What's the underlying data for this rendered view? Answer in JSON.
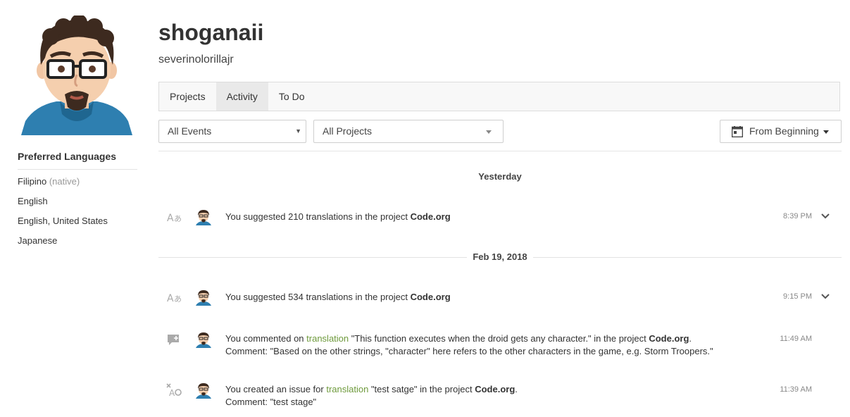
{
  "profile": {
    "display_name": "shoganaii",
    "username": "severinolorillajr"
  },
  "languages": {
    "title": "Preferred Languages",
    "items": [
      {
        "name": "Filipino",
        "note": "(native)"
      },
      {
        "name": "English",
        "note": ""
      },
      {
        "name": "English, United States",
        "note": ""
      },
      {
        "name": "Japanese",
        "note": ""
      }
    ]
  },
  "tabs": [
    {
      "label": "Projects",
      "active": false
    },
    {
      "label": "Activity",
      "active": true
    },
    {
      "label": "To Do",
      "active": false
    }
  ],
  "filters": {
    "events": "All Events",
    "projects": "All Projects",
    "date_range": "From Beginning"
  },
  "feed": {
    "groups": [
      {
        "date": "Yesterday"
      },
      {
        "date": "Feb 19, 2018"
      }
    ],
    "events": [
      {
        "icon": "translate-icon",
        "pre": "You suggested 210 translations in the project ",
        "project": "Code.org",
        "time": "8:39 PM"
      },
      {
        "icon": "translate-icon",
        "pre": "You suggested 534 translations in the project ",
        "project": "Code.org",
        "time": "9:15 PM"
      },
      {
        "icon": "comment-icon",
        "pre": "You commented on ",
        "link": "translation",
        "mid": " \"This function executes when the droid gets any character.\" in the project ",
        "project": "Code.org",
        "post": ".",
        "comment": "Comment: \"Based on the other strings, \"character\" here refers to the other characters in the game, e.g. Storm Troopers.\"",
        "time": "11:49 AM"
      },
      {
        "icon": "issue-icon",
        "pre": "You created an issue for ",
        "link": "translation",
        "mid": " \"test satge\" in the project ",
        "project": "Code.org",
        "post": ".",
        "comment": "Comment: \"test stage\"",
        "time": "11:39 AM"
      }
    ]
  },
  "colors": {
    "link": "#6e9a3c",
    "tab_active": "#e9e9e9"
  }
}
